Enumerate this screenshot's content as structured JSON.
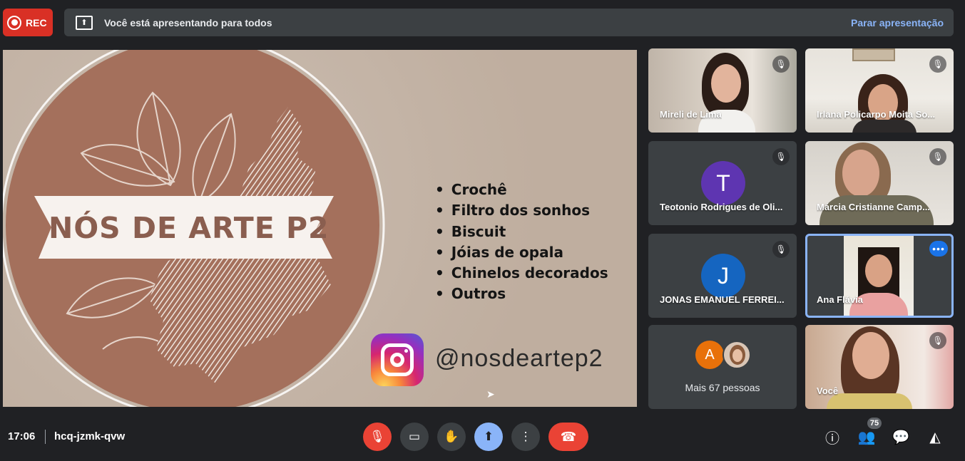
{
  "recording": {
    "label": "REC"
  },
  "banner": {
    "message": "Você está apresentando para todos",
    "stop_label": "Parar apresentação"
  },
  "slide": {
    "logo_text": "NÓS DE ARTE P2",
    "bullets": [
      "Crochê",
      "Filtro dos sonhos",
      "Biscuit",
      "Jóias de opala",
      "Chinelos decorados",
      "Outros"
    ],
    "instagram_handle": "@nosdeartep2"
  },
  "participants": [
    {
      "name": "Mireli de Lima",
      "muted": true
    },
    {
      "name": "Irlana Policarpo Moita So...",
      "muted": true
    },
    {
      "name": "Teotonio Rodrigues de Oli...",
      "initial": "T",
      "avatar_color": "#5e35b1",
      "muted": true
    },
    {
      "name": "Márcia Cristianne Camp...",
      "muted": true
    },
    {
      "name": "JONAS EMANUEL FERREI...",
      "initial": "J",
      "avatar_color": "#1565c0",
      "muted": true
    },
    {
      "name": "Ana Flávia",
      "active": true
    },
    {
      "more_label": "Mais 67 pessoas",
      "initial": "A",
      "avatar_color": "#e8710a"
    },
    {
      "name": "Você",
      "muted": true
    }
  ],
  "bottom_bar": {
    "time": "17:06",
    "meeting_code": "hcq-jzmk-qvw",
    "people_count": "75"
  },
  "icons": {
    "mic_off": "mic-off-icon",
    "camera": "camera-icon",
    "hand": "raise-hand-icon",
    "present": "present-icon",
    "more": "more-options-icon",
    "hangup": "hangup-icon",
    "info": "info-icon",
    "people": "people-icon",
    "chat": "chat-icon",
    "activities": "activities-icon"
  }
}
